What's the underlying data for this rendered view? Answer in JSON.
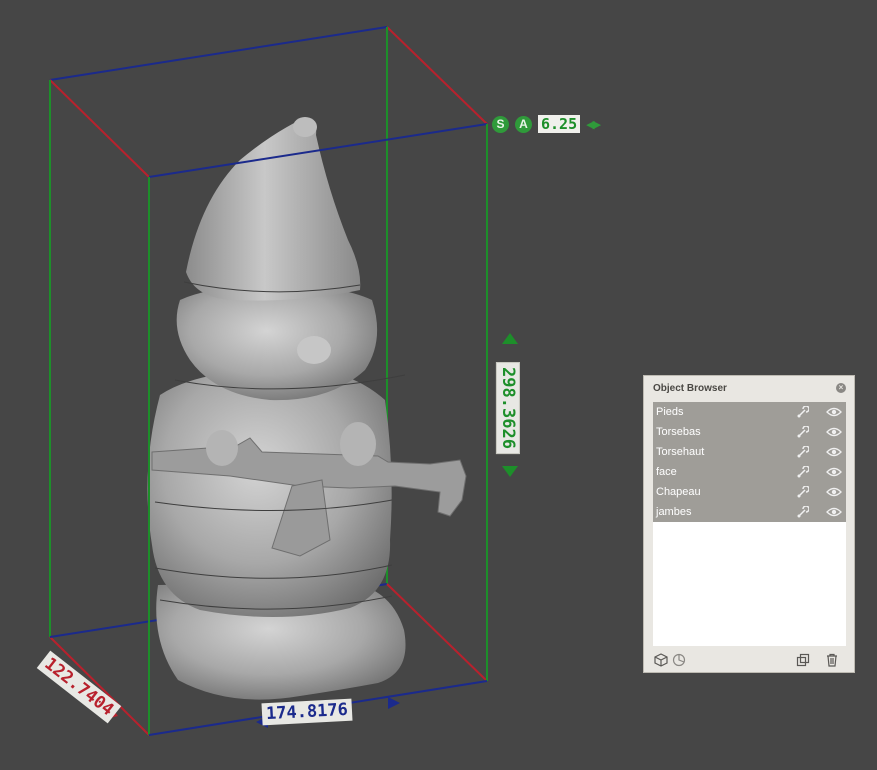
{
  "viewport": {
    "height_dimension": "298.3626",
    "width_dimension": "174.8176",
    "depth_dimension": "122.7404",
    "scale_s_label": "S",
    "scale_a_label": "A",
    "scale_value": "6.25",
    "colors": {
      "background": "#464646",
      "x_axis": "#b8212d",
      "y_axis": "#1b2a8c",
      "z_axis": "#1d8f2a",
      "model": "#a9a9a9"
    }
  },
  "object_browser": {
    "title": "Object Browser",
    "objects": [
      {
        "label": "Pieds"
      },
      {
        "label": "Torsebas"
      },
      {
        "label": "Torsehaut"
      },
      {
        "label": "face"
      },
      {
        "label": "Chapeau"
      },
      {
        "label": "jambes"
      }
    ],
    "icons": {
      "row_pick": "pick-icon",
      "row_visibility": "eye-icon",
      "footer": [
        "cube-icon",
        "texture-icon",
        "duplicate-icon",
        "trash-icon"
      ]
    }
  }
}
